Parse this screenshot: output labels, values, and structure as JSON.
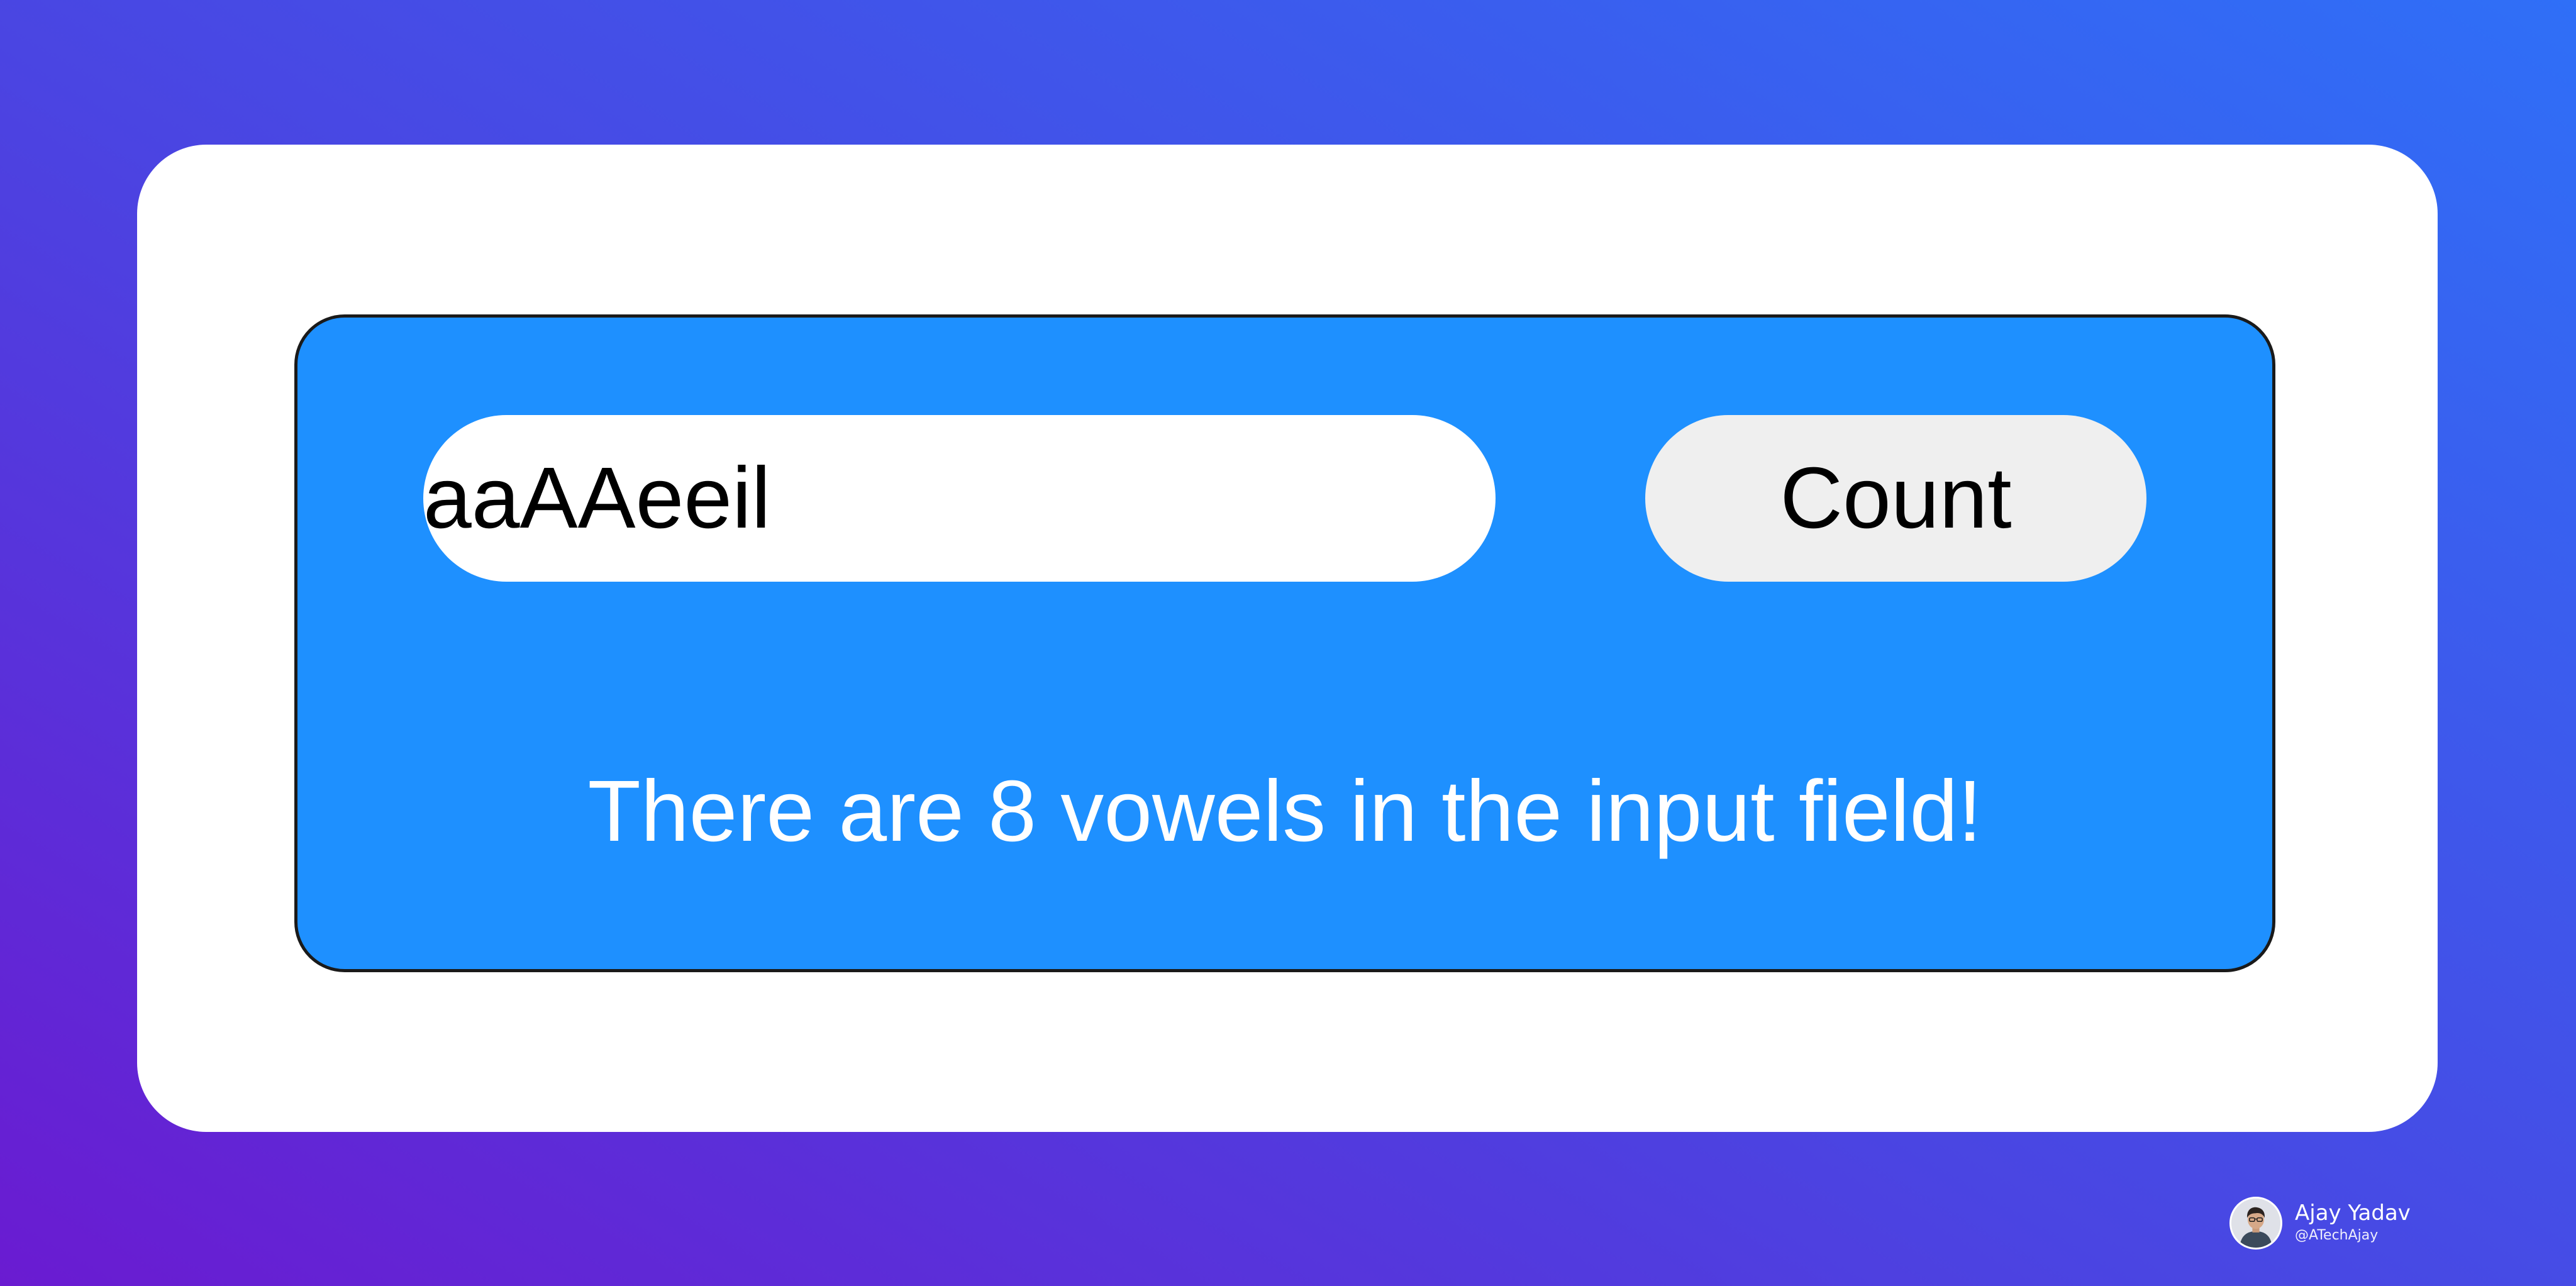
{
  "app": {
    "input_value": "aaAAeeil",
    "input_placeholder": "",
    "count_button_label": "Count",
    "result_text": "There are 8 vowels in the input field!",
    "vowel_count": 8
  },
  "author": {
    "name": "Ajay Yadav",
    "handle": "@ATechAjay",
    "avatar_icon": "person-avatar-icon"
  },
  "colors": {
    "background_gradient_start": "#6a1bd1",
    "background_gradient_end": "#2f6ff7",
    "card": "#ffffff",
    "panel": "#1e90ff",
    "button": "#efefef"
  }
}
